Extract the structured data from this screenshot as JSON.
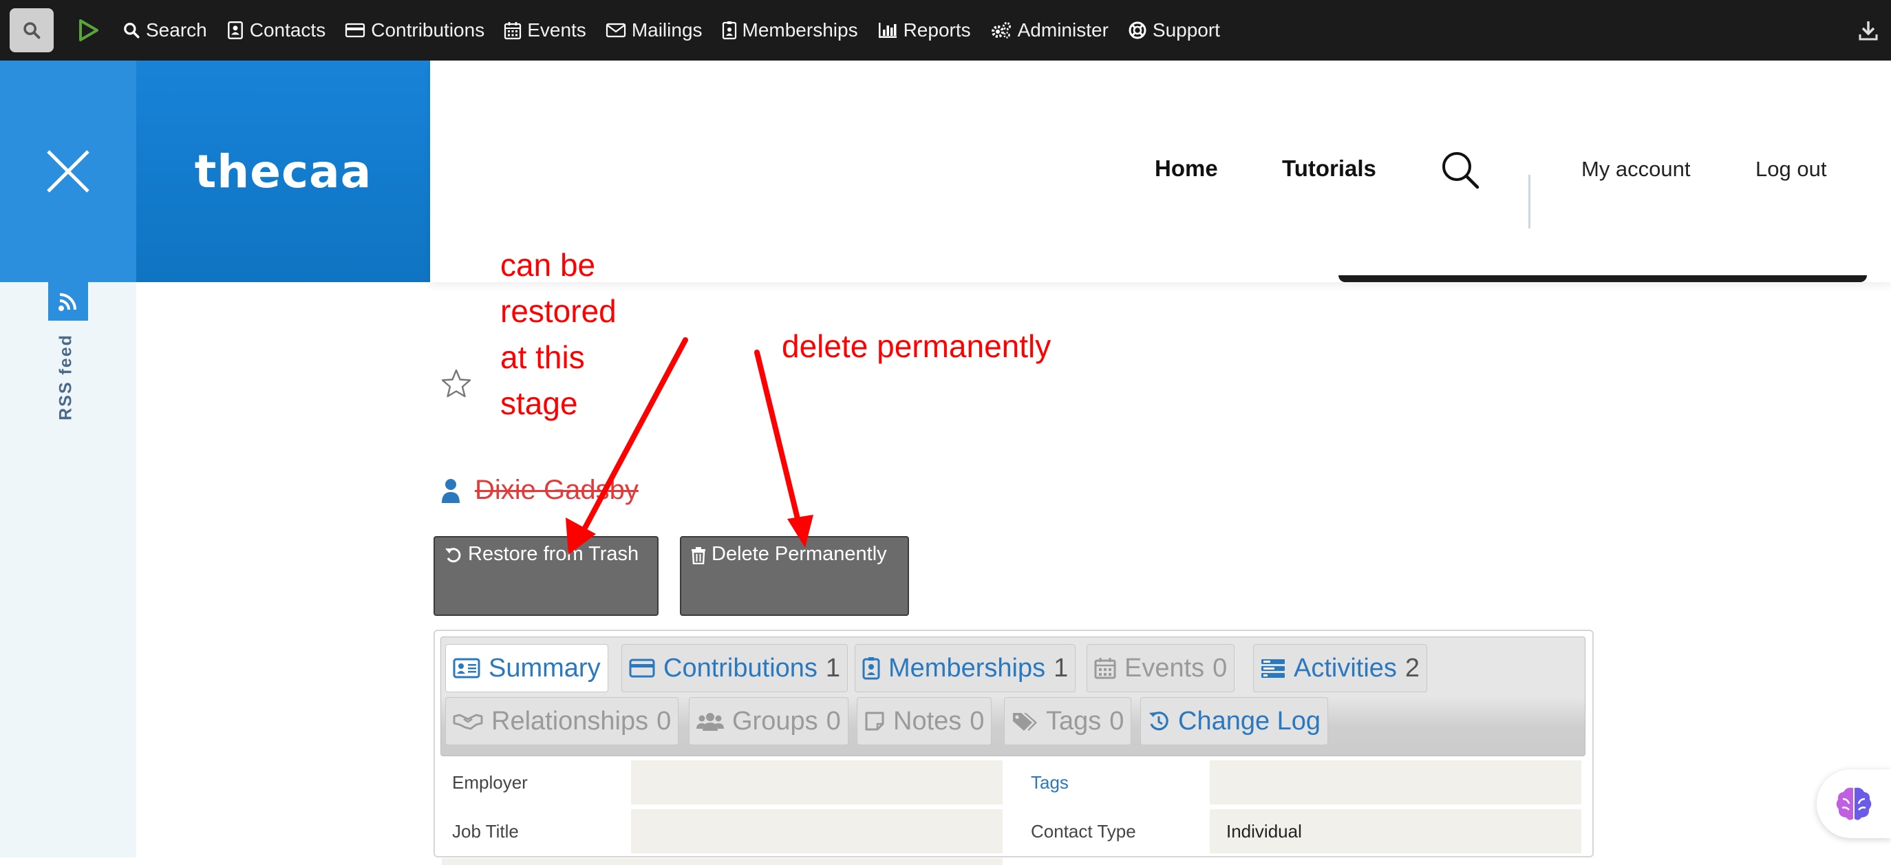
{
  "civi_menu": {
    "items": [
      {
        "label": "Search",
        "icon": "search-icon"
      },
      {
        "label": "Contacts",
        "icon": "contact-card-icon"
      },
      {
        "label": "Contributions",
        "icon": "credit-card-icon"
      },
      {
        "label": "Events",
        "icon": "calendar-icon"
      },
      {
        "label": "Mailings",
        "icon": "envelope-icon"
      },
      {
        "label": "Memberships",
        "icon": "id-badge-icon"
      },
      {
        "label": "Reports",
        "icon": "bar-chart-icon"
      },
      {
        "label": "Administer",
        "icon": "gears-icon"
      },
      {
        "label": "Support",
        "icon": "life-ring-icon"
      }
    ]
  },
  "site": {
    "brand": "thecaa",
    "nav": {
      "home": "Home",
      "tutorials": "Tutorials",
      "my_account": "My account",
      "log_out": "Log out"
    },
    "rss_label": "RSS feed"
  },
  "contact": {
    "name": "Dixie Gadsby",
    "restore_label": "Restore from Trash",
    "delete_label": "Delete Permanently"
  },
  "tabs": [
    {
      "label": "Summary",
      "count": "",
      "state": "active"
    },
    {
      "label": "Contributions",
      "count": "1",
      "state": "link"
    },
    {
      "label": "Memberships",
      "count": "1",
      "state": "link"
    },
    {
      "label": "Events",
      "count": "0",
      "state": "disabled"
    },
    {
      "label": "Activities",
      "count": "2",
      "state": "link"
    },
    {
      "label": "Relationships",
      "count": "0",
      "state": "disabled"
    },
    {
      "label": "Groups",
      "count": "0",
      "state": "disabled"
    },
    {
      "label": "Notes",
      "count": "0",
      "state": "disabled"
    },
    {
      "label": "Tags",
      "count": "0",
      "state": "disabled"
    },
    {
      "label": "Change Log",
      "count": "",
      "state": "link"
    }
  ],
  "summary": {
    "employer_label": "Employer",
    "job_title_label": "Job Title",
    "tags_label": "Tags",
    "contact_type_label": "Contact Type",
    "contact_type_value": "Individual"
  },
  "annotations": {
    "restore_note": [
      "can be",
      "restored",
      "at this",
      "stage"
    ],
    "delete_note": "delete permanently"
  },
  "colors": {
    "accent": "#2a78bd",
    "brand_blue": "#0f74c2",
    "annotation": "#ff0000",
    "trashed_name": "#e33a3a"
  }
}
